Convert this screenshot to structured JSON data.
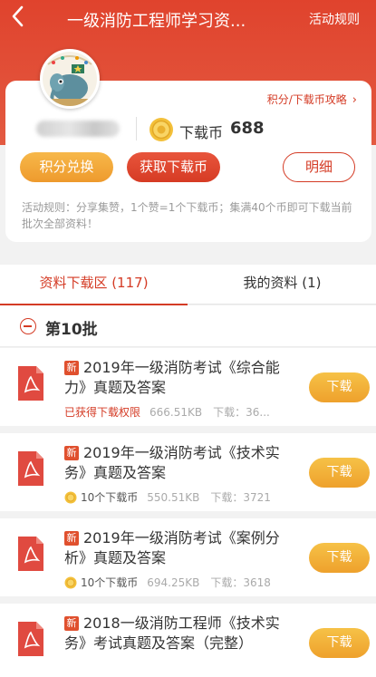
{
  "nav": {
    "back_icon": "chevron-left-icon",
    "title": "一级消防工程师学习资...",
    "right_action": "活动规则"
  },
  "profile": {
    "strategy_link": "积分/下载币攻略",
    "coin_label": "下载币",
    "coin_value": "688",
    "buttons": {
      "exchange": "积分兑换",
      "get_coins": "获取下载币",
      "detail": "明细"
    },
    "rules": "活动规则：分享集赞，1个赞=1个下载币；集满40个币即可下载当前批次全部资料！"
  },
  "tabs": [
    {
      "label": "资料下载区 (117)",
      "active": true
    },
    {
      "label": "我的资料 (1)",
      "active": false
    }
  ],
  "batch": {
    "title": "第10批"
  },
  "items": [
    {
      "tag": "新",
      "title": "2019年一级消防考试《综合能力》真题及答案",
      "status": "已获得下载权限",
      "cost": "",
      "size": "666.51KB",
      "downloads": "下载：36...",
      "button": "下载"
    },
    {
      "tag": "新",
      "title": "2019年一级消防考试《技术实务》真题及答案",
      "status": "",
      "cost": "10个下载币",
      "size": "550.51KB",
      "downloads": "下载：3721",
      "button": "下载"
    },
    {
      "tag": "新",
      "title": "2019年一级消防考试《案例分析》真题及答案",
      "status": "",
      "cost": "10个下载币",
      "size": "694.25KB",
      "downloads": "下载：3618",
      "button": "下载"
    },
    {
      "tag": "新",
      "title": "2018一级消防工程师《技术实务》考试真题及答案（完整）",
      "status": "",
      "cost": "",
      "size": "",
      "downloads": "",
      "button": "下载"
    }
  ],
  "colors": {
    "brand_red": "#d43b25",
    "header_red": "#e0432d",
    "gold": "#eea12c"
  }
}
